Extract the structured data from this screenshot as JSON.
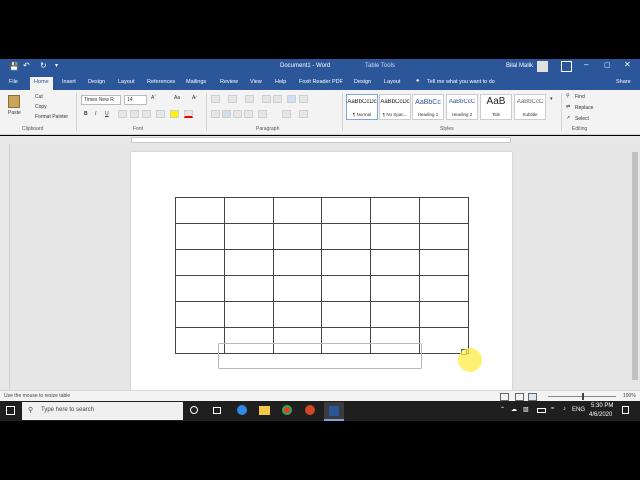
{
  "title_bar": {
    "save_icon": "save-icon",
    "undo_icon": "undo-icon",
    "redo_icon": "redo-icon",
    "doc_title": "Document1 - Word",
    "context_label": "Table Tools",
    "user_name": "Bilal Malik",
    "minimize_icon": "minimize-icon",
    "restore_icon": "restore-icon",
    "close_icon": "close-icon"
  },
  "ribbon_tabs": [
    "File",
    "Home",
    "Insert",
    "Design",
    "Layout",
    "References",
    "Mailings",
    "Review",
    "View",
    "Help",
    "Foxit Reader PDF",
    "Design",
    "Layout"
  ],
  "tell_me": "Tell me what you want to do",
  "share": "Share",
  "clipboard": {
    "paste": "Paste",
    "cut": "Cut",
    "copy": "Copy",
    "format_painter": "Format Painter",
    "label": "Clipboard"
  },
  "font": {
    "name": "Times New R",
    "size": "14",
    "label": "Font",
    "bold": "B",
    "italic": "I",
    "underline": "U",
    "font_size_menu": "Aa"
  },
  "paragraph": {
    "label": "Paragraph"
  },
  "styles": {
    "label": "Styles",
    "items": [
      {
        "preview": "AaBbCcDc",
        "name": "¶ Normal"
      },
      {
        "preview": "AaBbCcDc",
        "name": "¶ No Spac..."
      },
      {
        "preview": "AaBbCc",
        "name": "Heading 1"
      },
      {
        "preview": "AaBbCcC",
        "name": "Heading 2"
      },
      {
        "preview": "AaB",
        "name": "Title"
      },
      {
        "preview": "AaBbCcC",
        "name": "Subtitle"
      }
    ]
  },
  "editing": {
    "find": "Find",
    "replace": "Replace",
    "select": "Select",
    "label": "Editing"
  },
  "status": {
    "message": "Use the mouse to resize table",
    "zoom": "100%"
  },
  "table": {
    "rows": 6,
    "cols": 6
  },
  "taskbar": {
    "search_placeholder": "Type here to search",
    "language": "ENG",
    "time": "5:30 PM",
    "date": "4/6/2020"
  },
  "colors": {
    "word_blue": "#2b579a",
    "ribbon_bg": "#f3f3f3",
    "doc_bg": "#e6e6e6",
    "cursor_highlight": "#ffeb3b"
  }
}
